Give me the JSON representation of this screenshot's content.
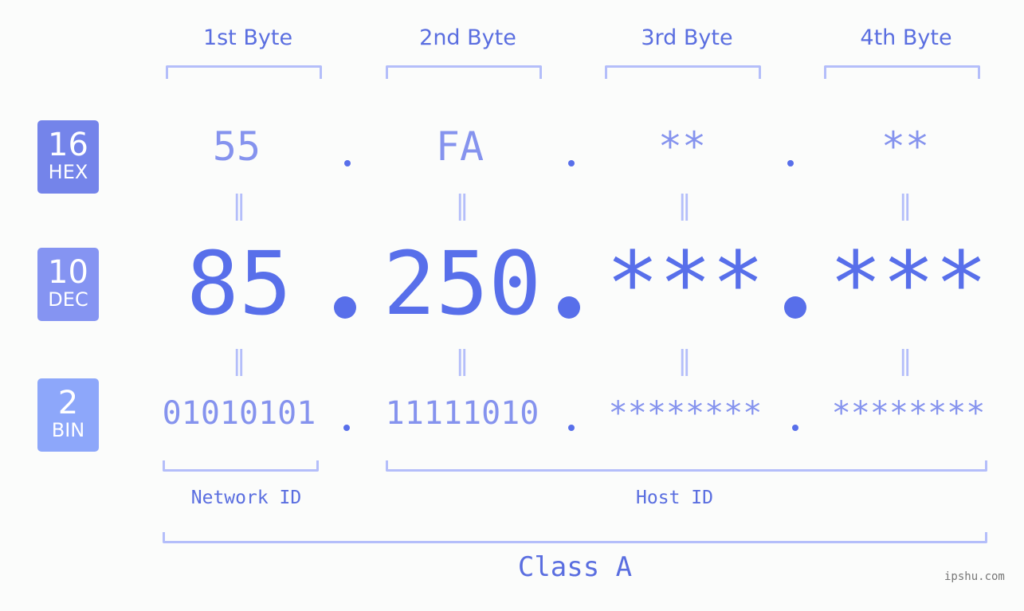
{
  "headers": [
    "1st Byte",
    "2nd Byte",
    "3rd Byte",
    "4th Byte"
  ],
  "badges": {
    "hex": {
      "num": "16",
      "label": "HEX",
      "color": "#7484ea"
    },
    "dec": {
      "num": "10",
      "label": "DEC",
      "color": "#8594f2"
    },
    "bin": {
      "num": "2",
      "label": "BIN",
      "color": "#8da7fa"
    }
  },
  "hex": [
    "55",
    "FA",
    "**",
    "**"
  ],
  "dec": [
    "85",
    "250",
    "***",
    "***"
  ],
  "bin": [
    "01010101",
    "11111010",
    "********",
    "********"
  ],
  "equals": "=",
  "network_id": "Network ID",
  "host_id": "Host ID",
  "class_label": "Class A",
  "watermark": "ipshu.com",
  "colors": {
    "accent": "#586fea",
    "light": "#8593ee",
    "bracket": "#b4befa"
  }
}
